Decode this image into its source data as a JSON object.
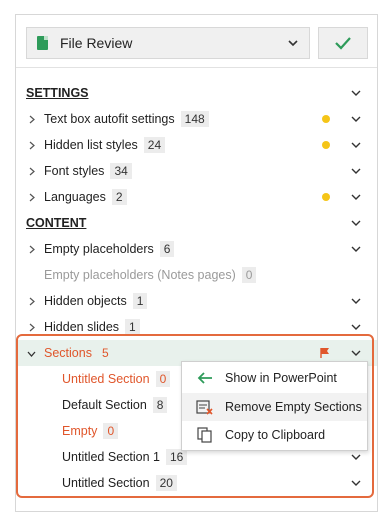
{
  "header": {
    "title": "File Review",
    "icons": {
      "doc": "document-icon",
      "chevron": "chevron-down-icon",
      "ok": "checkmark-icon"
    }
  },
  "colors": {
    "accent_green": "#2e9b5a",
    "warning_yellow": "#f5c518",
    "highlight_orange": "#e46a3d",
    "item_red": "#e0562b"
  },
  "settings": {
    "heading": "SETTINGS",
    "items": [
      {
        "label": "Text box autofit settings",
        "count": "148",
        "warning": true
      },
      {
        "label": "Hidden list styles",
        "count": "24",
        "warning": true
      },
      {
        "label": "Font styles",
        "count": "34",
        "warning": false
      },
      {
        "label": "Languages",
        "count": "2",
        "warning": true
      }
    ]
  },
  "content": {
    "heading": "CONTENT",
    "items": [
      {
        "label": "Empty placeholders",
        "count": "6"
      },
      {
        "label": "Empty placeholders (Notes pages)",
        "count": "0"
      },
      {
        "label": "Hidden objects",
        "count": "1"
      },
      {
        "label": "Hidden slides",
        "count": "1"
      }
    ],
    "sections": {
      "label": "Sections",
      "count": "5",
      "children": [
        {
          "label": "Untitled Section",
          "count": "0"
        },
        {
          "label": "Default Section",
          "count": "8"
        },
        {
          "label": "Empty",
          "count": "0"
        },
        {
          "label": "Untitled Section 1",
          "count": "16"
        },
        {
          "label": "Untitled Section",
          "count": "20"
        }
      ]
    }
  },
  "context_menu": {
    "items": [
      {
        "label": "Show in PowerPoint",
        "icon": "arrow-left-icon"
      },
      {
        "label": "Remove Empty Sections",
        "icon": "remove-sections-icon"
      },
      {
        "label": "Copy to Clipboard",
        "icon": "copy-icon"
      }
    ]
  }
}
